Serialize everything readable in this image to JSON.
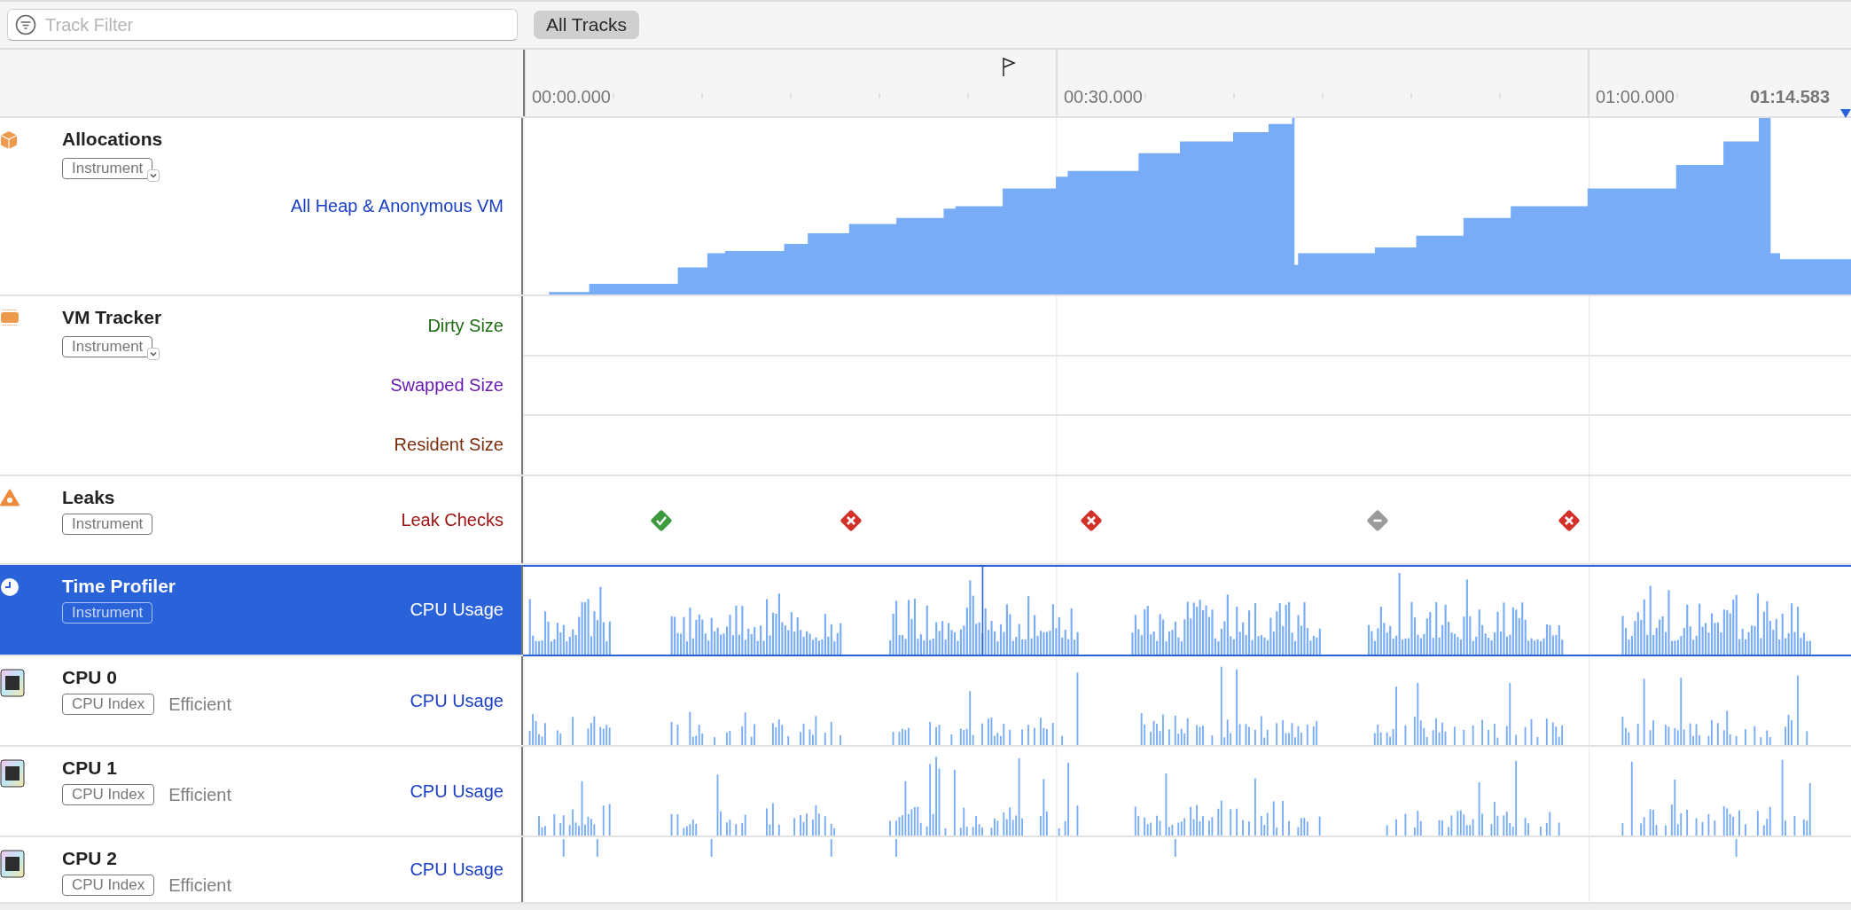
{
  "toolbar": {
    "search": {
      "placeholder": "Track Filter"
    },
    "scope_button": "All Tracks"
  },
  "timeline": {
    "ticks": [
      "00:00.000",
      "00:30.000",
      "01:00.000"
    ],
    "end_time": "01:14.583"
  },
  "tracks": [
    {
      "kind": "allocations",
      "name": "Allocations",
      "tag": "Instrument",
      "has_menu": true,
      "selected": false,
      "lanes": [
        {
          "label": "All Heap & Anonymous VM",
          "color": "#1a3fc4"
        }
      ]
    },
    {
      "kind": "vm",
      "name": "VM Tracker",
      "tag": "Instrument",
      "has_menu": true,
      "selected": false,
      "lanes": [
        {
          "label": "Dirty Size",
          "color": "#1d6b12"
        },
        {
          "label": "Swapped Size",
          "color": "#6a1db0"
        },
        {
          "label": "Resident Size",
          "color": "#7a2e0c"
        }
      ]
    },
    {
      "kind": "leaks",
      "name": "Leaks",
      "tag": "Instrument",
      "has_menu": false,
      "selected": false,
      "lanes": [
        {
          "label": "Leak Checks",
          "color": "#a01414"
        }
      ],
      "checks": [
        {
          "kind": "passed"
        },
        {
          "kind": "leaked"
        },
        {
          "kind": "leaked"
        },
        {
          "kind": "none"
        },
        {
          "kind": "leaked"
        }
      ]
    },
    {
      "kind": "profiler",
      "name": "Time Profiler",
      "tag": "Instrument",
      "has_menu": false,
      "selected": true,
      "lanes": [
        {
          "label": "CPU Usage"
        }
      ]
    },
    {
      "kind": "cpu",
      "name": "CPU 0",
      "tag": "CPU Index",
      "detail": "Efficient",
      "has_menu": false,
      "selected": false,
      "lanes": [
        {
          "label": "CPU Usage",
          "color": "#1a3fc4"
        }
      ]
    },
    {
      "kind": "cpu",
      "name": "CPU 1",
      "tag": "CPU Index",
      "detail": "Efficient",
      "has_menu": false,
      "selected": false,
      "lanes": [
        {
          "label": "CPU Usage",
          "color": "#1a3fc4"
        }
      ]
    },
    {
      "kind": "cpu",
      "name": "CPU 2",
      "tag": "CPU Index",
      "detail": "Efficient",
      "has_menu": false,
      "selected": false,
      "lanes": [
        {
          "label": "CPU Usage",
          "color": "#1a3fc4"
        }
      ]
    }
  ]
}
